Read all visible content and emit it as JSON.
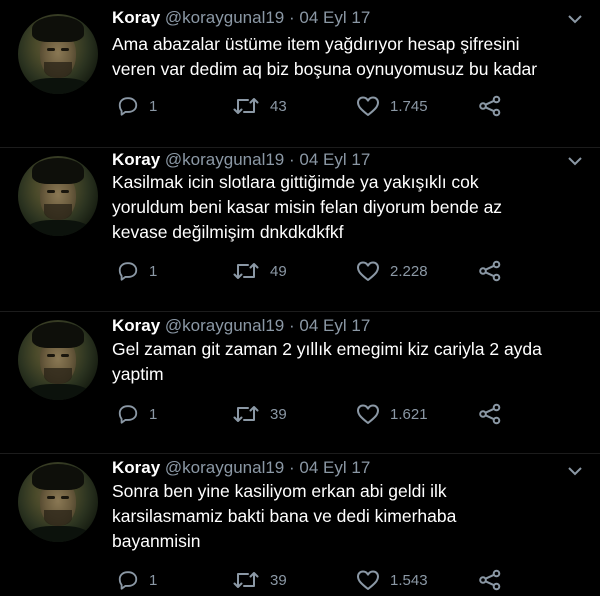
{
  "tweets": [
    {
      "name": "Koray",
      "handle": "@koraygunal19",
      "separator": "·",
      "date": "04 Eyl 17",
      "text": "Ama abazalar üstüme item yağdırıyor hesap şifresini\nveren var dedim aq biz boşuna oynuyomusuz bu kadar",
      "replies": "1",
      "retweets": "43",
      "likes": "1.745"
    },
    {
      "name": "Koray",
      "handle": "@koraygunal19",
      "separator": "·",
      "date": "04 Eyl 17",
      "text": "Kasilmak icin slotlara gittiğimde ya yakışıklı cok\nyoruldum beni kasar misin  felan diyorum bende az\nkevase değilmişim dnkdkdkfkf",
      "replies": "1",
      "retweets": "49",
      "likes": "2.228"
    },
    {
      "name": "Koray",
      "handle": "@koraygunal19",
      "separator": "·",
      "date": "04 Eyl 17",
      "text": "Gel zaman git zaman 2 yıllık emegimi kiz cariyla 2 ayda\nyaptim",
      "replies": "1",
      "retweets": "39",
      "likes": "1.621"
    },
    {
      "name": "Koray",
      "handle": "@koraygunal19",
      "separator": "·",
      "date": "04 Eyl 17",
      "text": "Sonra ben yine kasiliyom erkan abi geldi ilk\nkarsilasmamiz bakti bana ve dedi kimerhaba\nbayanmisin",
      "replies": "1",
      "retweets": "39",
      "likes": "1.543"
    }
  ],
  "icons": {
    "reply": "reply-icon",
    "retweet": "retweet-icon",
    "like": "heart-icon",
    "share": "share-icon",
    "menu": "chevron-down-icon"
  },
  "colors": {
    "background": "#000000",
    "text": "#ffffff",
    "secondary": "#8b98a5"
  }
}
